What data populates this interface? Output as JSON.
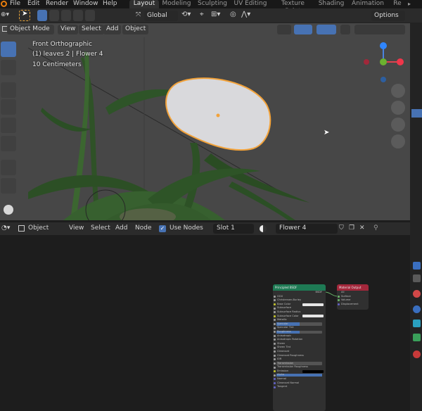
{
  "menubar": {
    "items": [
      "File",
      "Edit",
      "Render",
      "Window",
      "Help"
    ],
    "workspaces": [
      "Layout",
      "Modeling",
      "Sculpting",
      "UV Editing",
      "Texture Paint",
      "Shading",
      "Animation",
      "Re"
    ]
  },
  "tool_header": {
    "orientation": "Global",
    "options": "Options"
  },
  "viewport_header": {
    "mode": "Object Mode",
    "menus": [
      "View",
      "Select",
      "Add",
      "Object"
    ]
  },
  "viewport_overlay": {
    "view_name": "Front Orthographic",
    "collection_info": "(1) leaves 2 | Flower 4",
    "scale": "10 Centimeters"
  },
  "node_header": {
    "editor_type": "Object",
    "menus": [
      "View",
      "Select",
      "Add",
      "Node"
    ],
    "use_nodes": "Use Nodes",
    "slot": "Slot 1",
    "material": "Flower 4"
  },
  "nodes": {
    "principled": {
      "title": "Principled BSDF",
      "output": "BSDF",
      "rows": [
        "GGX",
        "Christensen-Burley",
        "Base Color",
        "Subsurface",
        "Subsurface Radius",
        "Subsurface Color",
        "Metallic",
        "Specular",
        "Specular Tint",
        "Roughness",
        "Anisotropic",
        "Anisotropic Rotation",
        "Sheen",
        "Sheen Tint",
        "Clearcoat",
        "Clearcoat Roughness",
        "IOR",
        "Transmission",
        "Transmission Roughness",
        "Emission",
        "Alpha",
        "Normal",
        "Clearcoat Normal",
        "Tangent"
      ]
    },
    "output": {
      "title": "Material Output",
      "rows": [
        "All",
        "Surface",
        "Volume",
        "Displacement"
      ]
    }
  },
  "colors": {
    "accent": "#4772b3",
    "selection_outline": "#f2a23a",
    "viewport_bg": "#474747",
    "shader_header": "#1e7a54",
    "output_header": "#a3273b"
  }
}
